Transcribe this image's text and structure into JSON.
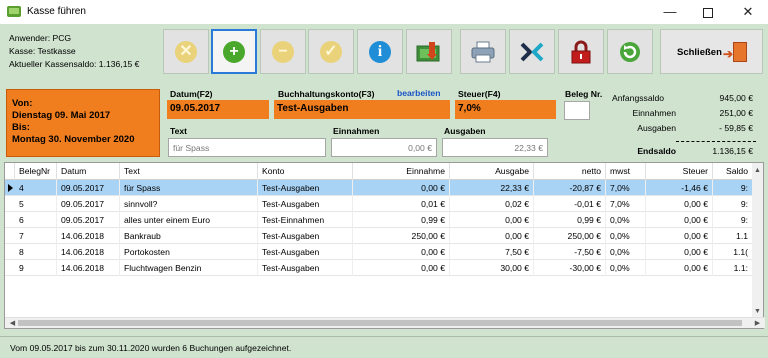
{
  "window": {
    "title": "Kasse führen",
    "min_glyph": "—",
    "close_glyph": "✕"
  },
  "info": {
    "user": "Anwender: PCG",
    "register": "Kasse: Testkasse",
    "balance": "Aktueller Kassensaldo: 1.136,15 €"
  },
  "toolbar": {
    "close_label": "Schließen",
    "icons": [
      "cancel-icon",
      "add-icon",
      "remove-icon",
      "confirm-icon",
      "info-icon",
      "cash-register-icon",
      "printer-icon",
      "export-icon",
      "lock-icon",
      "refresh-icon"
    ],
    "glyphs": {
      "cancel": "✕",
      "add": "+",
      "remove": "−",
      "confirm": "✓",
      "info": "i"
    }
  },
  "period": {
    "from_label": "Von:",
    "from_date": "Dienstag 09. Mai 2017",
    "to_label": "Bis:",
    "to_date": "Montag 30. November 2020"
  },
  "form": {
    "date_label": "Datum(F2)",
    "date_value": "09.05.2017",
    "account_label": "Buchhaltungskonto(F3)",
    "account_edit": "bearbeiten",
    "account_value": "Test-Ausgaben",
    "tax_label": "Steuer(F4)",
    "tax_value": "7,0%",
    "receipt_label": "Beleg Nr.",
    "text_label": "Text",
    "text_value": "für Spass",
    "income_label": "Einnahmen",
    "income_value": "0,00 €",
    "expense_label": "Ausgaben",
    "expense_value": "22,33 €"
  },
  "summary": {
    "opening_label": "Anfangssaldo",
    "opening_value": "945,00 €",
    "income_label": "Einnahmen",
    "income_value": "251,00 €",
    "expense_label": "Ausgaben",
    "expense_value": "- 59,85 €",
    "end_label": "Endsaldo",
    "end_value": "1.136,15 €"
  },
  "table": {
    "columns": [
      "BelegNr",
      "Datum",
      "Text",
      "Konto",
      "Einnahme",
      "Ausgabe",
      "netto",
      "mwst",
      "Steuer",
      "Saldo"
    ],
    "rows": [
      [
        "4",
        "09.05.2017",
        "für Spass",
        "Test-Ausgaben",
        "0,00 €",
        "22,33 €",
        "-20,87 €",
        "7,0%",
        "-1,46 €",
        "9:"
      ],
      [
        "5",
        "09.05.2017",
        "sinnvoll?",
        "Test-Ausgaben",
        "0,01 €",
        "0,02 €",
        "-0,01 €",
        "7,0%",
        "0,00 €",
        "9:"
      ],
      [
        "6",
        "09.05.2017",
        "alles unter einem Euro",
        "Test-Einnahmen",
        "0,99 €",
        "0,00 €",
        "0,99 €",
        "0,0%",
        "0,00 €",
        "9:"
      ],
      [
        "7",
        "14.06.2018",
        "Bankraub",
        "Test-Ausgaben",
        "250,00 €",
        "0,00 €",
        "250,00 €",
        "0,0%",
        "0,00 €",
        "1.1"
      ],
      [
        "8",
        "14.06.2018",
        "Portokosten",
        "Test-Ausgaben",
        "0,00 €",
        "7,50 €",
        "-7,50 €",
        "0,0%",
        "0,00 €",
        "1.1("
      ],
      [
        "9",
        "14.06.2018",
        "Fluchtwagen Benzin",
        "Test-Ausgaben",
        "0,00 €",
        "30,00 €",
        "-30,00 €",
        "0,0%",
        "0,00 €",
        "1.1:"
      ]
    ],
    "scroll_glyphs": {
      "up": "▲",
      "down": "▼",
      "left": "◀",
      "right": "▶"
    }
  },
  "status": "Vom 09.05.2017 bis zum 30.11.2020 wurden 6 Buchungen aufgezeichnet."
}
